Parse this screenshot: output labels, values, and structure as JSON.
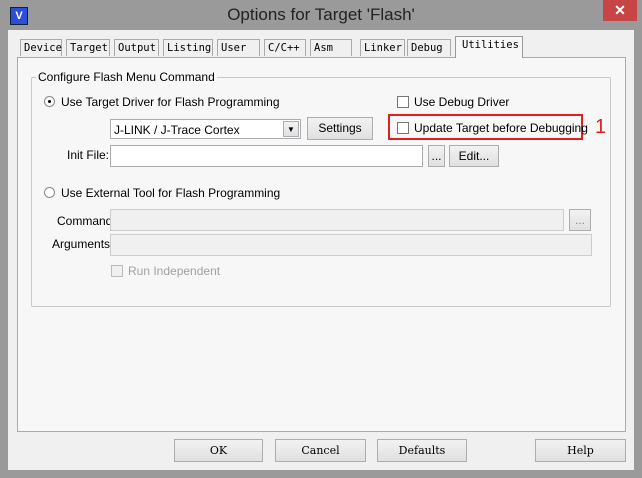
{
  "window": {
    "title": "Options for Target 'Flash'",
    "close": "✕",
    "icon": "keil-icon"
  },
  "tabs": [
    "Device",
    "Target",
    "Output",
    "Listing",
    "User",
    "C/C++",
    "Asm",
    "Linker",
    "Debug",
    "Utilities"
  ],
  "group": {
    "label": "Configure Flash Menu Command",
    "use_target_driver": "Use Target Driver for Flash Programming",
    "use_debug_driver": "Use Debug Driver",
    "driver_value": "J-LINK / J-Trace Cortex",
    "settings": "Settings",
    "update_target": "Update Target before Debugging",
    "init_file_label": "Init File:",
    "init_file_value": "",
    "browse": "...",
    "edit": "Edit...",
    "use_external_tool": "Use External Tool for Flash Programming",
    "command_label": "Command:",
    "arguments_label": "Arguments:",
    "run_independent": "Run Independent"
  },
  "annotation": {
    "number": "1",
    "color": "#e02020"
  },
  "buttons": {
    "ok": "OK",
    "cancel": "Cancel",
    "defaults": "Defaults",
    "help": "Help"
  }
}
